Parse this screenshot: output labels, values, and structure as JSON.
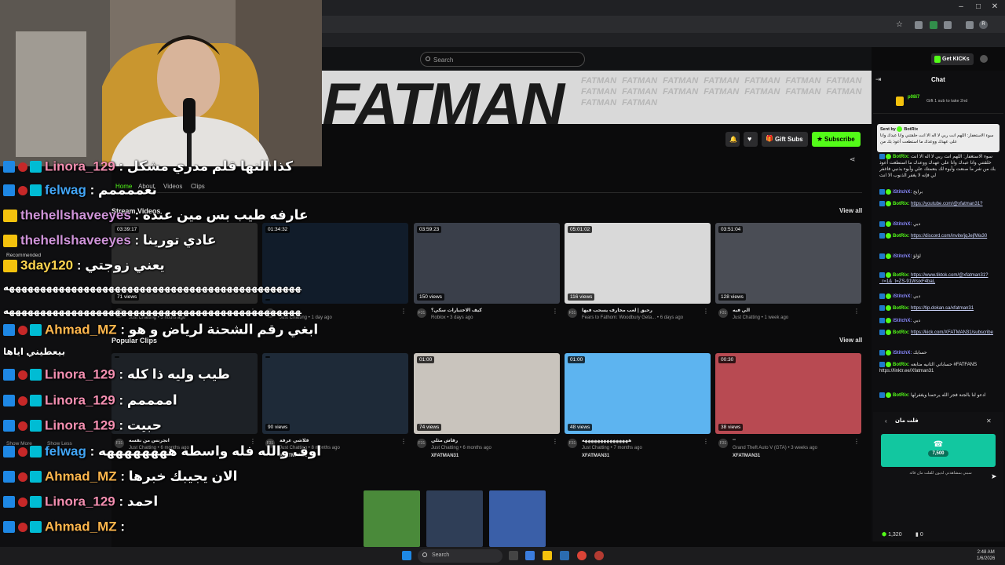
{
  "browser": {
    "toolbar_icons": [
      "star-icon",
      "extensions-icon",
      "profile-icon"
    ],
    "window_controls": [
      "minimize",
      "maximize",
      "close"
    ]
  },
  "site": {
    "search_placeholder": "Search",
    "get_kicks_label": "Get KICKs",
    "banner_text": "FATMAN",
    "banner_watermark": "FATMAN FATMAN FATMAN FATMAN FATMAN FATMAN FATMAN FATMAN FATMAN FATMAN FATMAN FATMAN FATMAN FATMAN FATMAN FATMAN",
    "gift_subs_label": "Gift Subs",
    "subscribe_label": "Subscribe",
    "tabs": [
      "Home",
      "About",
      "Videos",
      "Clips"
    ],
    "accent": "#53fc18"
  },
  "streams": {
    "header": "Stream Videos",
    "view_all": "View all",
    "items": [
      {
        "duration": "03:39:17",
        "views": "71 views",
        "title": "",
        "meta": "Just Chatting • 5 hours ago"
      },
      {
        "duration": "01:34:32",
        "views": "",
        "title": "",
        "meta": "Just Chatting • 1 day ago"
      },
      {
        "duration": "03:59:23",
        "views": "150 views",
        "title": "كيف الاختبارات سكي؟",
        "meta": "Roblox • 3 days ago"
      },
      {
        "duration": "05:01:02",
        "views": "116 views",
        "title": "رحيق | لعب مخارف يسحب فيها",
        "meta": "Fears to Fathom: Woodbury Geta... • 6 days ago"
      },
      {
        "duration": "03:51:04",
        "views": "128 views",
        "title": "الي فيه",
        "meta": "Just Chatting • 1 week ago"
      }
    ]
  },
  "clips": {
    "header": "Popular Clips",
    "view_all": "View all",
    "items": [
      {
        "duration": "",
        "views": "",
        "title": "انجرنس من نفسه",
        "meta": "Just Chatting • 6 months ago",
        "channel": ""
      },
      {
        "duration": "",
        "views": "90 views",
        "title": "فلاشي عرفة",
        "meta": "Just Chatting • 8 months ago",
        "channel": "XFATMAN31"
      },
      {
        "duration": "01:00",
        "views": "74 views",
        "title": "رفاش مثلي",
        "meta": "Just Chatting • 6 months ago",
        "channel": "XFATMAN31"
      },
      {
        "duration": "01:00",
        "views": "48 views",
        "title": "هههههههههههههههه",
        "meta": "Just Chatting • 7 months ago",
        "channel": "XFATMAN31"
      },
      {
        "duration": "00:30",
        "views": "38 views",
        "title": "--",
        "meta": "Grand Theft Auto V (GTA) • 3 weeks ago",
        "channel": "XFATMAN31"
      }
    ]
  },
  "chat": {
    "title": "Chat",
    "pinned_user": "p08i7",
    "pinned_text": "Gift 1 sub to take 2nd",
    "sent_by": "Sent by",
    "sent_by_user": "BotRix",
    "sent_text": "سوء الاستغفار: اللهم انت ربي لا اله الا انت خلقتني وانا عبدك وانا على عهدك ووعدك ما استطعت أعوذ بك من",
    "messages": [
      {
        "user": "BotRix:",
        "text": "سوء الاستغفار: اللهم انت ربي لا اله الا انت خلقتني وانا عبدك وانا على عهدك ووعدك ما استطعت أعوذ بك من شر ما صنعت وأبوء لك بنعمتك علي وأبوء بذنبي فاغفر لي فإنه لا يغفر الذنوب الا انت"
      },
      {
        "user": "iStitchX:",
        "text": "برايح"
      },
      {
        "user": "BotRix:",
        "text": "https://youtube.com/@xfatman31?"
      },
      {
        "user": "iStitchX:",
        "text": "دبي"
      },
      {
        "user": "BotRix:",
        "text": "https://discord.com/invite/jqJejfWa30"
      },
      {
        "user": "iStitchX:",
        "text": "لؤلؤ"
      },
      {
        "user": "BotRix:",
        "text": "https://www.tiktok.com/@xfatman31?_r=1&_t=ZS-91WsixF4baL"
      },
      {
        "user": "iStitchX:",
        "text": "دبي"
      },
      {
        "user": "BotRix:",
        "text": "https://tip.dokan.sa/xfatman31"
      },
      {
        "user": "iStitchX:",
        "text": "دبي"
      },
      {
        "user": "BotRix:",
        "text": "https://kick.com/XFATMAN31/subscribe"
      },
      {
        "user": "iStitchX:",
        "text": "حسابك"
      },
      {
        "user": "BotRix:",
        "text": "حساباتي الثانيه متابعه #FATFANS https://linktr.ee/Xfatman31"
      },
      {
        "user": "BotRix:",
        "text": "ادعو لنا بالجنة فجر الله يرحمنا ويغفرلها"
      }
    ],
    "gift_popup_title": "فلت مان",
    "gift_amount": "7,500",
    "gift_caption": "سبني بمشاهدتي لديون للفلت مان قائه",
    "gift_sub_caption": "",
    "kicks_balance": "1,320",
    "other_balance": "0"
  },
  "overlay_chat": [
    {
      "name": "Linora_129",
      "color": "#f48fb1",
      "text": "كذا النها قلم مدري مشكل"
    },
    {
      "name": "felwag",
      "color": "#42a5f5",
      "text": "نعممممم"
    },
    {
      "name": "thehellshaveeyes",
      "color": "#ce93d8",
      "text": "عارفه طيب بس مين عنده"
    },
    {
      "name": "thehellshaveeyes",
      "color": "#ce93d8",
      "text": "عادي تورينا"
    },
    {
      "name": "3day120",
      "color": "#ffd54f",
      "text": "يعني زوجتي"
    },
    {
      "name": "",
      "color": "#ffffff",
      "text": "هههههههههههههههههههههههههههههههههههههههههههههههههههههههههههههههههه"
    },
    {
      "name": "",
      "color": "#ffffff",
      "text": "هههههههههههههههههههههههههههههههههههههههههههههههههههههههههههههههههه"
    },
    {
      "name": "Ahmad_MZ",
      "color": "#ffb74d",
      "text": "ابغي رقم الشحنة لرياض و هو"
    },
    {
      "name": "",
      "color": "#ffffff",
      "text": "بيعطيني اياها"
    },
    {
      "name": "Linora_129",
      "color": "#f48fb1",
      "text": "طيب وليه ذا كله"
    },
    {
      "name": "Linora_129",
      "color": "#f48fb1",
      "text": "اممممم"
    },
    {
      "name": "Linora_129",
      "color": "#f48fb1",
      "text": "حبيت"
    },
    {
      "name": "felwag",
      "color": "#42a5f5",
      "text": "اوف والله فله واسطه ههههههههه"
    },
    {
      "name": "Ahmad_MZ",
      "color": "#ffb74d",
      "text": "الان يجيبك خبرها"
    },
    {
      "name": "Linora_129",
      "color": "#f48fb1",
      "text": "احمد"
    },
    {
      "name": "Ahmad_MZ",
      "color": "#ffb74d",
      "text": ""
    }
  ],
  "sidebar_ghost": {
    "recommended": "Recommended",
    "show_more": "Show More",
    "show_less": "Show Less"
  },
  "taskbar": {
    "search": "Search",
    "time": "2:48 AM",
    "date": "1/6/2026"
  }
}
